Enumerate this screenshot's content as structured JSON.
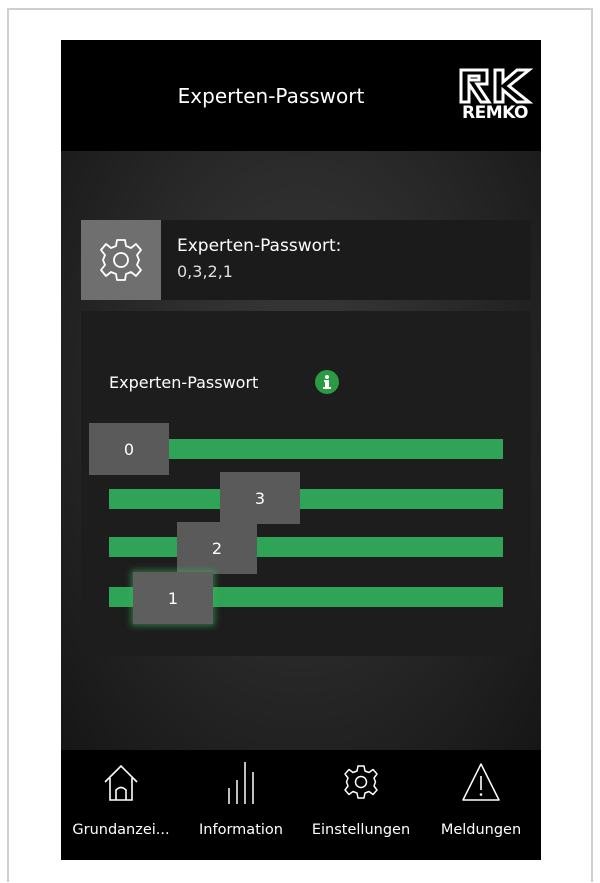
{
  "header": {
    "title": "Experten-Passwort",
    "logo_text": "REMKO"
  },
  "info_card": {
    "title": "Experten-Passwort:",
    "value": "0,3,2,1",
    "icon": "gear-icon"
  },
  "panel": {
    "label": "Experten-Passwort",
    "info_icon": "info-icon",
    "sliders": [
      {
        "value": "0"
      },
      {
        "value": "3"
      },
      {
        "value": "2"
      },
      {
        "value": "1"
      }
    ]
  },
  "footer": {
    "items": [
      {
        "label": "Grundanzei...",
        "icon": "home-icon"
      },
      {
        "label": "Information",
        "icon": "bars-icon"
      },
      {
        "label": "Einstellungen",
        "icon": "gear-icon"
      },
      {
        "label": "Meldungen",
        "icon": "warning-icon"
      }
    ]
  },
  "colors": {
    "accent_green": "#2fa457",
    "background": "#000000"
  }
}
